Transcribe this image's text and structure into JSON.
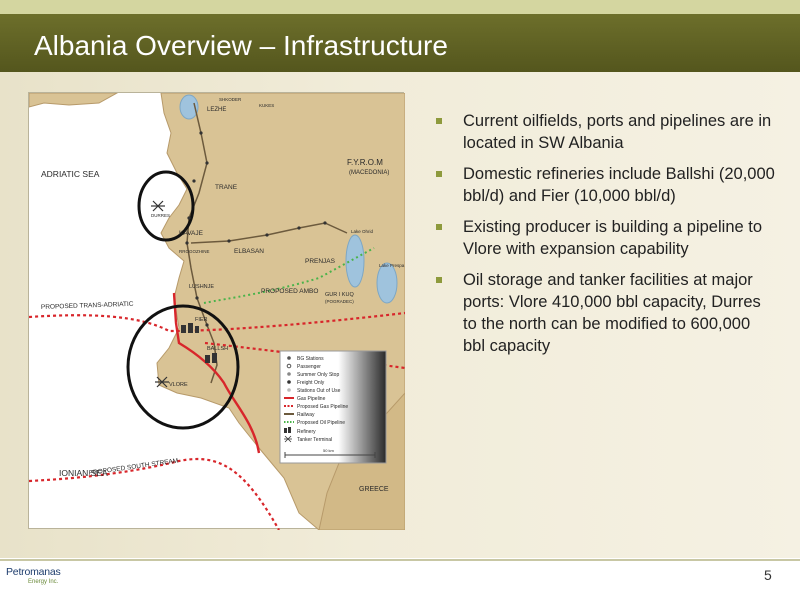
{
  "slide": {
    "title": "Albania Overview – Infrastructure",
    "page_number": "5",
    "logo": {
      "name": "Petromanas",
      "tagline": "Energy Inc."
    }
  },
  "bullets": [
    "Current oilfields, ports and pipelines are in located in SW Albania",
    "Domestic refineries include Ballshi (20,000 bbl/d) and Fier (10,000 bbl/d)",
    "Existing producer is building a pipeline to Vlore with expansion capability",
    "Oil storage and tanker facilities at major ports: Vlore 410,000 bbl capacity, Durres to the north can be modified to 600,000 bbl capacity"
  ],
  "map": {
    "labels": {
      "adriatic_sea": "ADRIATIC SEA",
      "ionian_sea": "IONIAN SEA",
      "fyrom": "F.Y.R.O.M",
      "macedonia": "(MACEDONIA)",
      "greece": "GREECE",
      "trans_adriatic": "PROPOSED TRANS-ADRIATIC",
      "south_stream": "PROPOSED SOUTH STREAM",
      "ambo": "PROPOSED AMBO",
      "lake_ohrid": "Lake Ohrid",
      "lake_prespa": "Lake Prespa",
      "scale": "50 km"
    },
    "towns": {
      "lezhe": "LEZHE",
      "trane": "TRANE",
      "kavaje": "KAVAJE",
      "elbasan": "ELBASAN",
      "prenjas": "PRENJAS",
      "fier": "FIER",
      "ballsh": "BALLSH",
      "vlore": "VLORE",
      "rrogozhine": "RROGOZHINE",
      "lushnje": "LUSHNJE",
      "gur_i_kuq": "GUR I KUQ",
      "pogradec": "(POGRADEC)",
      "kukes": "KUKES",
      "shkoder": "SHKODER",
      "durres": "DURRES"
    },
    "legend": [
      {
        "label": "BG Stations",
        "icon": "station-icon"
      },
      {
        "label": "Passenger",
        "icon": "passenger-icon"
      },
      {
        "label": "Summer Only Stop",
        "icon": "summer-stop-icon"
      },
      {
        "label": "Freight Only",
        "icon": "freight-icon"
      },
      {
        "label": "Stations Out of Use",
        "icon": "closed-station-icon"
      },
      {
        "label": "Gas Pipeline",
        "icon": "gas-pipeline-line"
      },
      {
        "label": "Proposed Gas Pipeline",
        "icon": "proposed-gas-pipeline-line"
      },
      {
        "label": "Railway",
        "icon": "railway-line"
      },
      {
        "label": "Proposed Oil Pipeline",
        "icon": "proposed-oil-pipeline-line"
      },
      {
        "label": "Refinery",
        "icon": "refinery-icon"
      },
      {
        "label": "Tanker Terminal",
        "icon": "tanker-terminal-icon"
      }
    ],
    "colors": {
      "sea": "#ffffff",
      "land": "#d9c395",
      "gas_pipeline": "#d8262b",
      "proposed_pipeline": "#d8262b",
      "railway": "#6c5a3d",
      "proposed_oil": "#49b34a",
      "highlight_circle": "#111111",
      "lake": "#9fc3dd"
    }
  }
}
